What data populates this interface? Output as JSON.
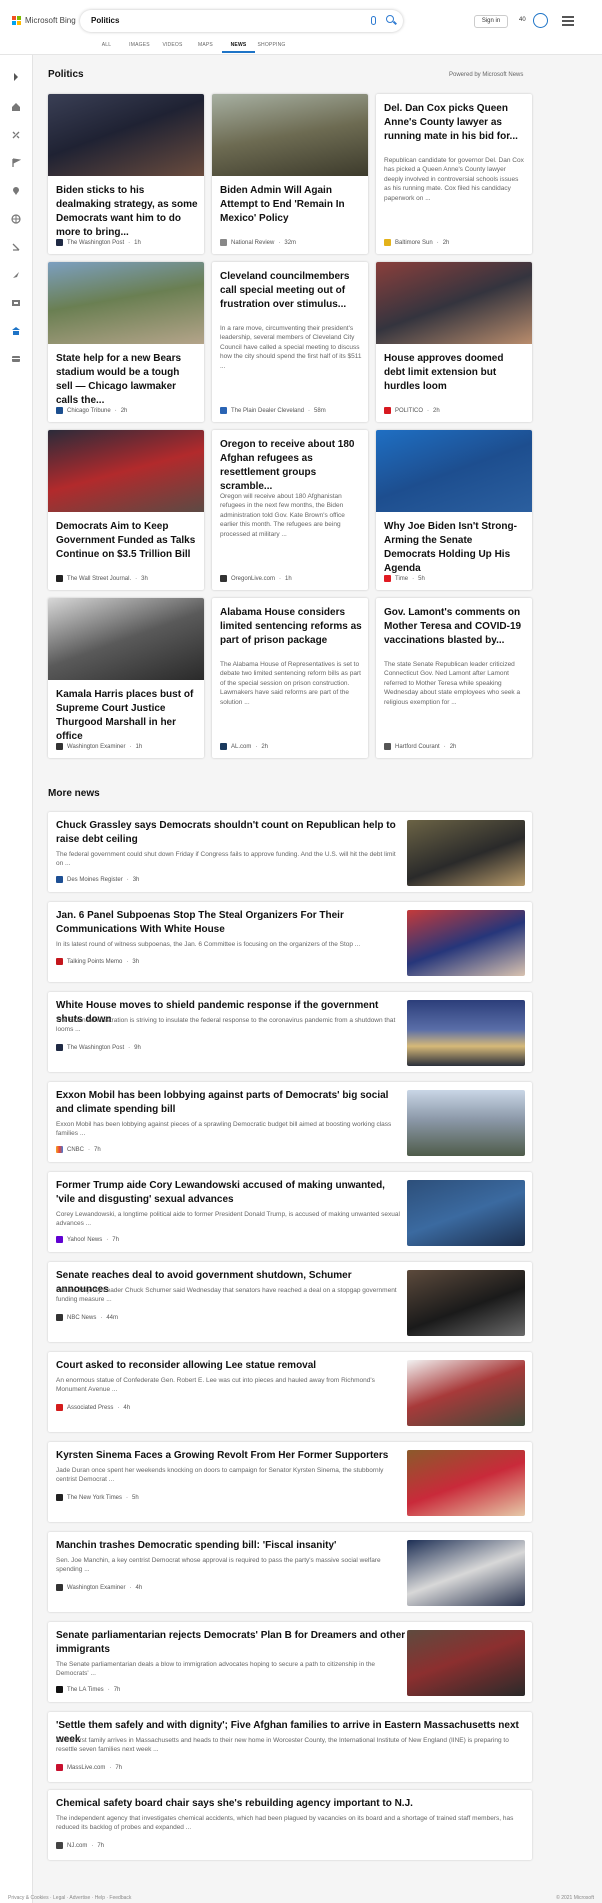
{
  "header": {
    "brand": "Microsoft Bing",
    "query": "Politics",
    "sign_in": "Sign in",
    "points": "40",
    "tabs": [
      "ALL",
      "IMAGES",
      "VIDEOS",
      "MAPS",
      "NEWS",
      "SHOPPING"
    ],
    "active_tab": "NEWS"
  },
  "sidebar": {
    "items": [
      "arrow-right-icon",
      "home-icon",
      "sparkle-icon",
      "flag-icon",
      "location-icon",
      "globe-icon",
      "scale-icon",
      "rocket-icon",
      "film-icon",
      "politics-icon",
      "card-icon"
    ]
  },
  "section": {
    "title": "Politics",
    "powered_by": "Powered by Microsoft News"
  },
  "cards": [
    {
      "title": "Biden sticks to his dealmaking strategy, as some Democrats want him to do more to bring...",
      "source": "The Washington Post",
      "time": "1h",
      "summary": ""
    },
    {
      "title": "Biden Admin Will Again Attempt to End 'Remain In Mexico' Policy",
      "source": "National Review",
      "time": "32m",
      "summary": ""
    },
    {
      "title": "Del. Dan Cox picks Queen Anne's County lawyer as running mate in his bid for...",
      "source": "Baltimore Sun",
      "time": "2h",
      "summary": "Republican candidate for governor Del. Dan Cox has picked a Queen Anne's County lawyer deeply involved in controversial schools issues as his running mate. Cox filed his candidacy paperwork on ..."
    },
    {
      "title": "State help for a new Bears stadium would be a tough sell — Chicago lawmaker calls the...",
      "source": "Chicago Tribune",
      "time": "2h",
      "summary": ""
    },
    {
      "title": "Cleveland councilmembers call special meeting out of frustration over stimulus...",
      "source": "The Plain Dealer Cleveland",
      "time": "58m",
      "summary": "In a rare move, circumventing their president's leadership, several members of Cleveland City Council have called a special meeting to discuss how the city should spend the first half of its $511 ..."
    },
    {
      "title": "House approves doomed debt limit extension but hurdles loom",
      "source": "POLITICO",
      "time": "2h",
      "summary": ""
    },
    {
      "title": "Democrats Aim to Keep Government Funded as Talks Continue on $3.5 Trillion Bill",
      "source": "The Wall Street Journal.",
      "time": "3h",
      "summary": ""
    },
    {
      "title": "Oregon to receive about 180 Afghan refugees as resettlement groups scramble...",
      "source": "OregonLive.com",
      "time": "1h",
      "summary": "Oregon will receive about 180 Afghanistan refugees in the next few months, the Biden administration told Gov. Kate Brown's office earlier this month. The refugees are being processed at military ..."
    },
    {
      "title": "Why Joe Biden Isn't Strong-Arming the Senate Democrats Holding Up His Agenda",
      "source": "Time",
      "time": "5h",
      "summary": ""
    },
    {
      "title": "Kamala Harris places bust of Supreme Court Justice Thurgood Marshall in her office",
      "source": "Washington Examiner",
      "time": "1h",
      "summary": ""
    },
    {
      "title": "Alabama House considers limited sentencing reforms as part of prison package",
      "source": "AL.com",
      "time": "2h",
      "summary": "The Alabama House of Representatives is set to debate two limited sentencing reform bills as part of the special session on prison construction. Lawmakers have said reforms are part of the solution ..."
    },
    {
      "title": "Gov. Lamont's comments on Mother Teresa and COVID-19 vaccinations blasted by...",
      "source": "Hartford Courant",
      "time": "2h",
      "summary": "The state Senate Republican leader criticized Connecticut Gov. Ned Lamont after Lamont referred to Mother Teresa while speaking Wednesday about state employees who seek a religious exemption for ..."
    }
  ],
  "more_news": {
    "title": "More news",
    "items": [
      {
        "title": "Chuck Grassley says Democrats shouldn't count on Republican help to raise debt ceiling",
        "summary": "The federal government could shut down Friday if Congress fails to approve funding. And the U.S. will hit the debt limit on ...",
        "source": "Des Moines Register",
        "time": "3h"
      },
      {
        "title": "Jan. 6 Panel Subpoenas Stop The Steal Organizers For Their Communications With White House",
        "summary": "In its latest round of witness subpoenas, the Jan. 6 Committee is focusing on the organizers of the Stop ...",
        "source": "Talking Points Memo",
        "time": "3h"
      },
      {
        "title": "White House moves to shield pandemic response if the government shuts down",
        "summary": "The Biden administration is striving to insulate the federal response to the coronavirus pandemic from a shutdown that looms ...",
        "source": "The Washington Post",
        "time": "9h"
      },
      {
        "title": "Exxon Mobil has been lobbying against parts of Democrats' big social and climate spending bill",
        "summary": "Exxon Mobil has been lobbying against pieces of a sprawling Democratic budget bill aimed at boosting working class families ...",
        "source": "CNBC",
        "time": "7h"
      },
      {
        "title": "Former Trump aide Cory Lewandowski accused of making unwanted, 'vile and disgusting' sexual advances",
        "summary": "Corey Lewandowski, a longtime political aide to former President Donald Trump, is accused of making unwanted sexual advances ...",
        "source": "Yahoo! News",
        "time": "7h"
      },
      {
        "title": "Senate reaches deal to avoid government shutdown, Schumer announces",
        "summary": "Senate Majority Leader Chuck Schumer said Wednesday that senators have reached a deal on a stopgap government funding measure ...",
        "source": "NBC News",
        "time": "44m"
      },
      {
        "title": "Court asked to reconsider allowing Lee statue removal",
        "summary": "An enormous statue of Confederate Gen. Robert E. Lee was cut into pieces and hauled away from Richmond's Monument Avenue ...",
        "source": "Associated Press",
        "time": "4h"
      },
      {
        "title": "Kyrsten Sinema Faces a Growing Revolt From Her Former Supporters",
        "summary": "Jade Duran once spent her weekends knocking on doors to campaign for Senator Kyrsten Sinema, the stubbornly centrist Democrat ...",
        "source": "The New York Times",
        "time": "5h"
      },
      {
        "title": "Manchin trashes Democratic spending bill: 'Fiscal insanity'",
        "summary": "Sen. Joe Manchin, a key centrist Democrat whose approval is required to pass the party's massive social welfare spending ...",
        "source": "Washington Examiner",
        "time": "4h"
      },
      {
        "title": "Senate parliamentarian rejects Democrats' Plan B for Dreamers and other immigrants",
        "summary": "The Senate parliamentarian deals a blow to immigration advocates hoping to secure a path to citizenship in the Democrats' ...",
        "source": "The LA Times",
        "time": "7h"
      },
      {
        "title": "'Settle them safely and with dignity'; Five Afghan families to arrive in Eastern Massachusetts next week",
        "summary": "As the first family arrives in Massachusetts and heads to their new home in Worcester County, the International Institute of New England (IINE) is preparing to resettle seven families next week ...",
        "source": "MassLive.com",
        "time": "7h"
      },
      {
        "title": "Chemical safety board chair says she's rebuilding agency important to N.J.",
        "summary": "The independent agency that investigates chemical accidents, which had been plagued by vacancies on its board and a shortage of trained staff members, has reduced its backlog of probes and expanded ...",
        "source": "NJ.com",
        "time": "7h"
      }
    ]
  },
  "footer": {
    "left": "Privacy & Cookies · Legal · Advertise · Help · Feedback",
    "right": "© 2021 Microsoft"
  }
}
